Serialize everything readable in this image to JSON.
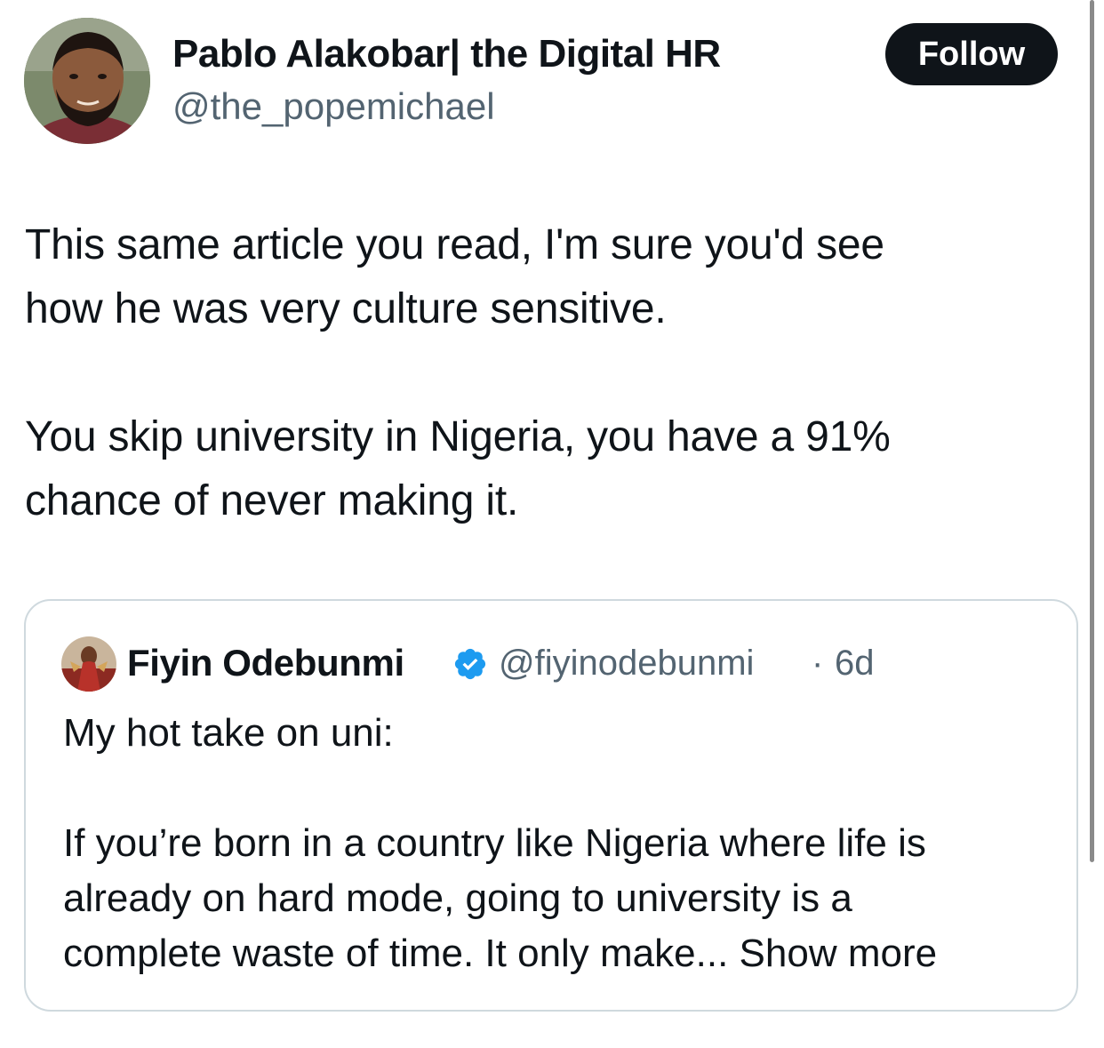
{
  "author": {
    "name": "Pablo Alakobar| the Digital HR",
    "handle": "@the_popemichael",
    "avatar_icon": "person-avatar-icon"
  },
  "follow_button": {
    "label": "Follow"
  },
  "tweet": {
    "text": "This same article you read, I'm sure you'd see\nhow he was very culture sensitive.\n\nYou skip university in Nigeria, you have a 91%\nchance of never making it."
  },
  "quoted_tweet": {
    "author_name": "Fiyin Odebunmi",
    "verified_icon": "verified-badge-icon",
    "handle": "@fiyinodebunmi",
    "separator": "·",
    "time": "6d",
    "text": "My hot take on uni:\n\nIf you’re born in a country like Nigeria where life is\nalready on hard mode, going to university is a\ncomplete waste of time. It only make...",
    "show_more_label": " Show more"
  },
  "colors": {
    "text": "#0f1419",
    "secondary_text": "#536471",
    "verified_blue": "#1d9bf0",
    "border": "#cfd9de",
    "button_bg": "#0f1419"
  }
}
